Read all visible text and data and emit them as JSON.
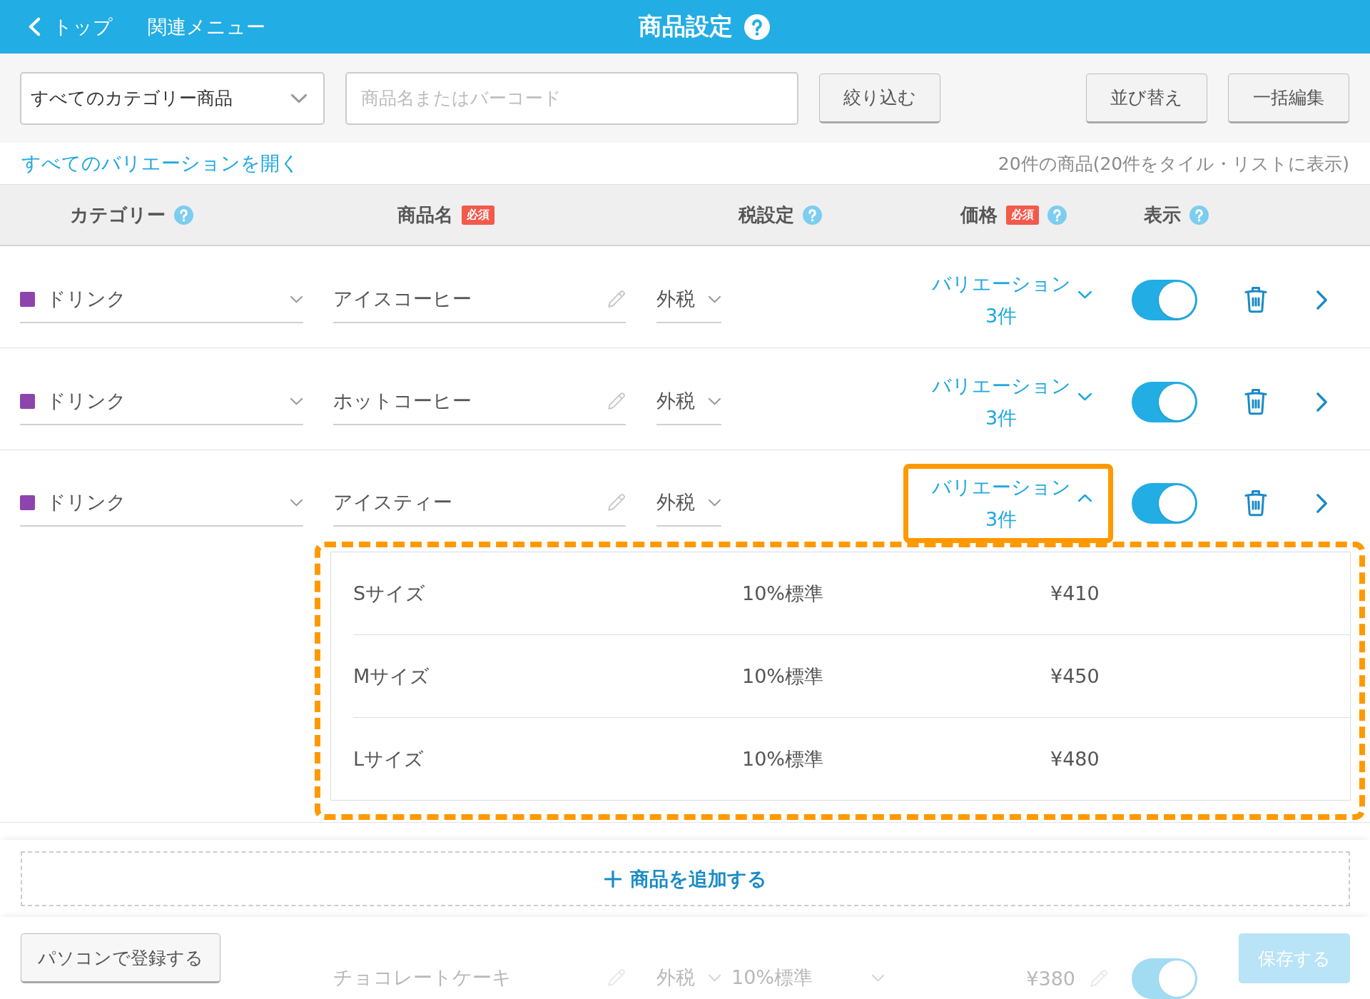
{
  "top_bar": {
    "back_link": "トップ",
    "menu_link": "関連メニュー",
    "title": "商品設定",
    "help": true
  },
  "toolbar": {
    "category_select": "すべてのカテゴリー商品",
    "search": {
      "placeholder": "商品名またはバーコード"
    },
    "filter_button": "絞り込む",
    "buttons": [
      "並び替え",
      "一括編集"
    ]
  },
  "list_info": {
    "expand_all_link": "すべてのバリエーションを開く",
    "count": "20件の商品(20件をタイル・リストに表示)"
  },
  "columns": [
    {
      "label": "カテゴリー",
      "help": true
    },
    {
      "label": "商品名",
      "badge": "必須",
      "help": false
    },
    {
      "label": "税設定",
      "help": true
    },
    {
      "label": "価格",
      "badge": "必須",
      "help": true
    },
    {
      "label": "表示",
      "help": true
    }
  ],
  "rows": [
    {
      "kind": "variations",
      "faded": false,
      "highlighted": false,
      "category": {
        "label": "ドリンク",
        "color": "#8e44ad"
      },
      "name": "アイスコーヒー",
      "tax": "外税",
      "price": {
        "label": "バリエーション",
        "count": "3件",
        "expanded": false
      },
      "visible": true
    },
    {
      "kind": "variations",
      "faded": false,
      "highlighted": false,
      "category": {
        "label": "ドリンク",
        "color": "#8e44ad"
      },
      "name": "ホットコーヒー",
      "tax": "外税",
      "price": {
        "label": "バリエーション",
        "count": "3件",
        "expanded": false
      },
      "visible": true
    },
    {
      "kind": "variations",
      "faded": false,
      "highlighted": true,
      "category": {
        "label": "ドリンク",
        "color": "#8e44ad"
      },
      "name": "アイスティー",
      "tax": "外税",
      "price": {
        "label": "バリエーション",
        "count": "3件",
        "expanded": true
      },
      "visible": true,
      "variations": [
        {
          "name": "Sサイズ",
          "tax_rate": "10%標準",
          "price": "¥410"
        },
        {
          "name": "Mサイズ",
          "tax_rate": "10%標準",
          "price": "¥450"
        },
        {
          "name": "Lサイズ",
          "tax_rate": "10%標準",
          "price": "¥480"
        }
      ]
    },
    {
      "kind": "single",
      "faded": true,
      "name": "チョコレートケーキ",
      "tax": "外税",
      "tax_rate": "10%標準",
      "price": "¥380",
      "visible": true
    }
  ],
  "add_button": "商品を追加する",
  "footer": {
    "pc_button": "パソコンで登録する",
    "save_button": {
      "label": "保存する",
      "disabled": true
    }
  }
}
